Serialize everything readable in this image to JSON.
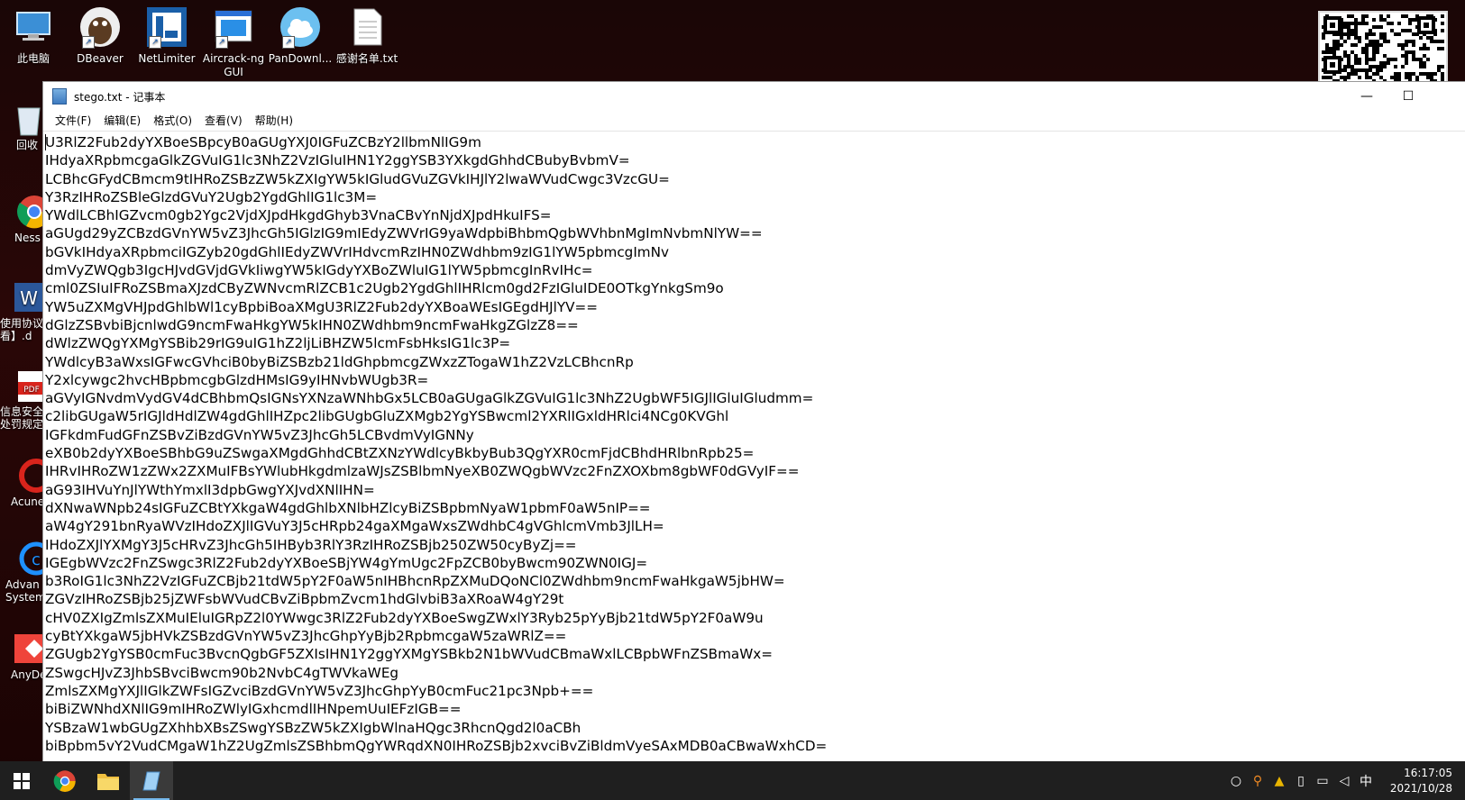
{
  "desktop": {
    "top_icons": [
      {
        "label": "此电脑"
      },
      {
        "label": "DBeaver"
      },
      {
        "label": "NetLimiter"
      },
      {
        "label": "Aircrack-ng GUI"
      },
      {
        "label": "PanDownl..."
      },
      {
        "label": "感谢名单.txt"
      }
    ],
    "left_icons": [
      {
        "label": "回收"
      },
      {
        "label": "Ness"
      },
      {
        "label": "使用协议看】.d"
      },
      {
        "label": "信息安全处罚规定"
      },
      {
        "label": "Acune"
      },
      {
        "label": "Advan System"
      },
      {
        "label": "AnyDe"
      }
    ],
    "left_icon_glyphs": [
      "W",
      "PDF"
    ]
  },
  "notepad": {
    "title": "stego.txt - 记事本",
    "minimize_glyph": "—",
    "maximize_glyph": "☐",
    "menus": [
      "文件(F)",
      "编辑(E)",
      "格式(O)",
      "查看(V)",
      "帮助(H)"
    ],
    "content": "U3RlZ2Fub2dyYXBoeSBpcyB0aGUgYXJ0IGFuZCBzY2llbmNlIG9m\nIHdyaXRpbmcgaGlkZGVuIG1lc3NhZ2VzIGluIHN1Y2ggYSB3YXkgdGhhdCBubyBvbmV=\nLCBhcGFydCBmcm9tIHRoZSBzZW5kZXIgYW5kIGludGVuZGVkIHJlY2lwaWVudCwgc3VzcGU=\nY3RzIHRoZSBleGlzdGVuY2Ugb2YgdGhlIG1lc3M=\nYWdlLCBhIGZvcm0gb2Ygc2VjdXJpdHkgdGhyb3VnaCBvYnNjdXJpdHkuIFS=\naGUgd29yZCBzdGVnYW5vZ3JhcGh5IGlzIG9mIEdyZWVrIG9yaWdpbiBhbmQgbWVhbnMgImNvbmNlYW==\nbGVkIHdyaXRpbmciIGZyb20gdGhlIEdyZWVrIHdvcmRzIHN0ZWdhbm9zIG1lYW5pbmcgImNv\ndmVyZWQgb3IgcHJvdGVjdGVkIiwgYW5kIGdyYXBoZWluIG1lYW5pbmcgInRvIHc=\ncml0ZSIuIFRoZSBmaXJzdCByZWNvcmRlZCB1c2Ugb2YgdGhlIHRlcm0gd2FzIGluIDE0OTkgYnkgSm9o\nYW5uZXMgVHJpdGhlbWl1cyBpbiBoaXMgU3RlZ2Fub2dyYXBoaWEsIGEgdHJlYV==\ndGlzZSBvbiBjcnlwdG9ncmFwaHkgYW5kIHN0ZWdhbm9ncmFwaHkgZGlzZ8==\ndWlzZWQgYXMgYSBib29rIG9uIG1hZ2ljLiBHZW5lcmFsbHksIG1lc3P=\nYWdlcyB3aWxsIGFwcGVhciB0byBiZSBzb21ldGhpbmcgZWxzZTogaW1hZ2VzLCBhcnRp\nY2xlcywgc2hvcHBpbmcgbGlzdHMsIG9yIHNvbWUgb3R=\naGVyIGNvdmVydGV4dCBhbmQsIGNsYXNzaWNhbGx5LCB0aGUgaGlkZGVuIG1lc3NhZ2UgbWF5IGJlIGluIGludmm=\nc2libGUgaW5rIGJldHdlZW4gdGhlIHZpc2libGUgbGluZXMgb2YgYSBwcml2YXRlIGxldHRlci4NCg0KVGhl\nIGFkdmFudGFnZSBvZiBzdGVnYW5vZ3JhcGh5LCBvdmVyIGNNy\neXB0b2dyYXBoeSBhbG9uZSwgaXMgdGhhdCBtZXNzYWdlcyBkbyBub3QgYXR0cmFjdCBhdHRlbnRpb25=\nIHRvIHRoZW1zZWx2ZXMuIFBsYWlubHkgdmlzaWJsZSBlbmNyeXB0ZWQgbWVzc2FnZXOXbm8gbWF0dGVyIF==\naG93IHVuYnJlYWthYmxlI3dpbGwgYXJvdXNlIHN=\ndXNwaWNpb24sIGFuZCBtYXkgaW4gdGhlbXNlbHZlcyBiZSBpbmNyaW1pbmF0aW5nIP==\naW4gY291bnRyaWVzIHdoZXJlIGVuY3J5cHRpb24gaXMgaWxsZWdhbC4gVGhlcmVmb3JlLH=\nIHdoZXJlYXMgY3J5cHRvZ3JhcGh5IHByb3RlY3RzIHRoZSBjb250ZW50cyByZj==\nIGEgbWVzc2FnZSwgc3RlZ2Fub2dyYXBoeSBjYW4gYmUgc2FpZCB0byBwcm90ZWN0IGJ=\nb3RoIG1lc3NhZ2VzIGFuZCBjb21tdW5pY2F0aW5nIHBhcnRpZXMuDQoNCl0ZWdhbm9ncmFwaHkgaW5jbHW=\nZGVzIHRoZSBjb25jZWFsbWVudCBvZiBpbmZvcm1hdGlvbiB3aXRoaW4gY29t\ncHV0ZXIgZmlsZXMuIEluIGRpZ2l0YWwgc3RlZ2Fub2dyYXBoeSwgZWxlY3Ryb25pYyBjb21tdW5pY2F0aW9u\ncyBtYXkgaW5jbHVkZSBzdGVnYW5vZ3JhcGhpYyBjb2RpbmcgaW5zaWRlZ==\nZGUgb2YgYSB0cmFuc3BvcnQgbGF5ZXIsIHN1Y2ggYXMgYSBkb2N1bWVudCBmaWxlLCBpbWFnZSBmaWx=\nZSwgcHJvZ3JhbSBvciBwcm90b2NvbC4gTWVkaWEg\nZmlsZXMgYXJlIGlkZWFsIGZvciBzdGVnYW5vZ3JhcGhpYyB0cmFuc21pc3Npb+==\nbiBiZWNhdXNlIG9mIHRoZWlyIGxhcmdlIHNpemUuIEFzIGB==\nYSBzaW1wbGUgZXhhbXBsZSwgYSBzZW5kZXIgbWlnaHQgc3RhcnQgd2l0aCBh\nbiBpbm5vY2VudCMgaW1hZ2UgZmlsZSBhbmQgYWRqdXN0IHRoZSBjb2xvciBvZiBldmVyeSAxMDB0aCBwaWxhCD="
  },
  "taskbar": {
    "ime": "中",
    "time": "16:17:05",
    "date": "2021/10/28"
  }
}
